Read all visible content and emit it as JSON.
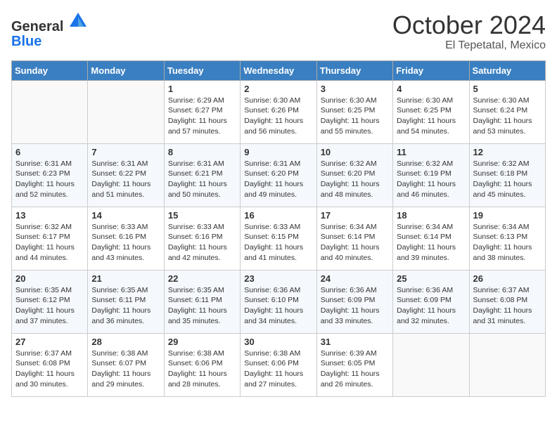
{
  "logo": {
    "general": "General",
    "blue": "Blue"
  },
  "title": {
    "month": "October 2024",
    "location": "El Tepetatal, Mexico"
  },
  "headers": [
    "Sunday",
    "Monday",
    "Tuesday",
    "Wednesday",
    "Thursday",
    "Friday",
    "Saturday"
  ],
  "weeks": [
    [
      {
        "day": "",
        "info": ""
      },
      {
        "day": "",
        "info": ""
      },
      {
        "day": "1",
        "info": "Sunrise: 6:29 AM\nSunset: 6:27 PM\nDaylight: 11 hours and 57 minutes."
      },
      {
        "day": "2",
        "info": "Sunrise: 6:30 AM\nSunset: 6:26 PM\nDaylight: 11 hours and 56 minutes."
      },
      {
        "day": "3",
        "info": "Sunrise: 6:30 AM\nSunset: 6:25 PM\nDaylight: 11 hours and 55 minutes."
      },
      {
        "day": "4",
        "info": "Sunrise: 6:30 AM\nSunset: 6:25 PM\nDaylight: 11 hours and 54 minutes."
      },
      {
        "day": "5",
        "info": "Sunrise: 6:30 AM\nSunset: 6:24 PM\nDaylight: 11 hours and 53 minutes."
      }
    ],
    [
      {
        "day": "6",
        "info": "Sunrise: 6:31 AM\nSunset: 6:23 PM\nDaylight: 11 hours and 52 minutes."
      },
      {
        "day": "7",
        "info": "Sunrise: 6:31 AM\nSunset: 6:22 PM\nDaylight: 11 hours and 51 minutes."
      },
      {
        "day": "8",
        "info": "Sunrise: 6:31 AM\nSunset: 6:21 PM\nDaylight: 11 hours and 50 minutes."
      },
      {
        "day": "9",
        "info": "Sunrise: 6:31 AM\nSunset: 6:20 PM\nDaylight: 11 hours and 49 minutes."
      },
      {
        "day": "10",
        "info": "Sunrise: 6:32 AM\nSunset: 6:20 PM\nDaylight: 11 hours and 48 minutes."
      },
      {
        "day": "11",
        "info": "Sunrise: 6:32 AM\nSunset: 6:19 PM\nDaylight: 11 hours and 46 minutes."
      },
      {
        "day": "12",
        "info": "Sunrise: 6:32 AM\nSunset: 6:18 PM\nDaylight: 11 hours and 45 minutes."
      }
    ],
    [
      {
        "day": "13",
        "info": "Sunrise: 6:32 AM\nSunset: 6:17 PM\nDaylight: 11 hours and 44 minutes."
      },
      {
        "day": "14",
        "info": "Sunrise: 6:33 AM\nSunset: 6:16 PM\nDaylight: 11 hours and 43 minutes."
      },
      {
        "day": "15",
        "info": "Sunrise: 6:33 AM\nSunset: 6:16 PM\nDaylight: 11 hours and 42 minutes."
      },
      {
        "day": "16",
        "info": "Sunrise: 6:33 AM\nSunset: 6:15 PM\nDaylight: 11 hours and 41 minutes."
      },
      {
        "day": "17",
        "info": "Sunrise: 6:34 AM\nSunset: 6:14 PM\nDaylight: 11 hours and 40 minutes."
      },
      {
        "day": "18",
        "info": "Sunrise: 6:34 AM\nSunset: 6:14 PM\nDaylight: 11 hours and 39 minutes."
      },
      {
        "day": "19",
        "info": "Sunrise: 6:34 AM\nSunset: 6:13 PM\nDaylight: 11 hours and 38 minutes."
      }
    ],
    [
      {
        "day": "20",
        "info": "Sunrise: 6:35 AM\nSunset: 6:12 PM\nDaylight: 11 hours and 37 minutes."
      },
      {
        "day": "21",
        "info": "Sunrise: 6:35 AM\nSunset: 6:11 PM\nDaylight: 11 hours and 36 minutes."
      },
      {
        "day": "22",
        "info": "Sunrise: 6:35 AM\nSunset: 6:11 PM\nDaylight: 11 hours and 35 minutes."
      },
      {
        "day": "23",
        "info": "Sunrise: 6:36 AM\nSunset: 6:10 PM\nDaylight: 11 hours and 34 minutes."
      },
      {
        "day": "24",
        "info": "Sunrise: 6:36 AM\nSunset: 6:09 PM\nDaylight: 11 hours and 33 minutes."
      },
      {
        "day": "25",
        "info": "Sunrise: 6:36 AM\nSunset: 6:09 PM\nDaylight: 11 hours and 32 minutes."
      },
      {
        "day": "26",
        "info": "Sunrise: 6:37 AM\nSunset: 6:08 PM\nDaylight: 11 hours and 31 minutes."
      }
    ],
    [
      {
        "day": "27",
        "info": "Sunrise: 6:37 AM\nSunset: 6:08 PM\nDaylight: 11 hours and 30 minutes."
      },
      {
        "day": "28",
        "info": "Sunrise: 6:38 AM\nSunset: 6:07 PM\nDaylight: 11 hours and 29 minutes."
      },
      {
        "day": "29",
        "info": "Sunrise: 6:38 AM\nSunset: 6:06 PM\nDaylight: 11 hours and 28 minutes."
      },
      {
        "day": "30",
        "info": "Sunrise: 6:38 AM\nSunset: 6:06 PM\nDaylight: 11 hours and 27 minutes."
      },
      {
        "day": "31",
        "info": "Sunrise: 6:39 AM\nSunset: 6:05 PM\nDaylight: 11 hours and 26 minutes."
      },
      {
        "day": "",
        "info": ""
      },
      {
        "day": "",
        "info": ""
      }
    ]
  ]
}
